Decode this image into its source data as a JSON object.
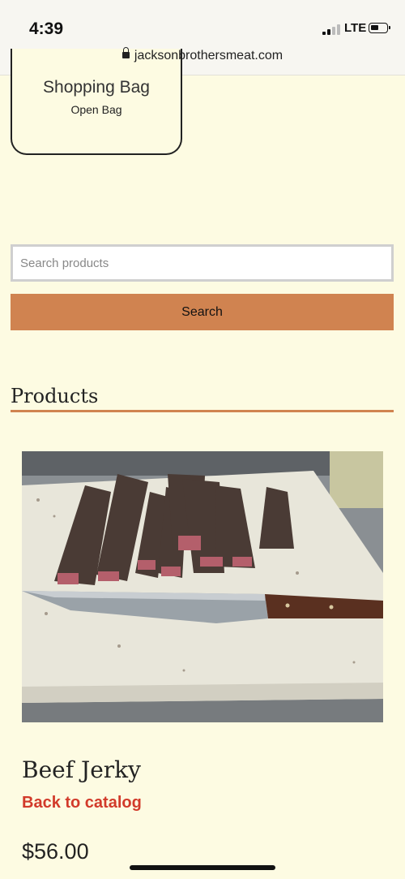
{
  "status": {
    "time": "4:39",
    "network": "LTE",
    "url": "jacksonbrothersmeat.com"
  },
  "cart": {
    "title": "Shopping Bag",
    "open_label": "Open Bag"
  },
  "search": {
    "placeholder": "Search products",
    "button_label": "Search"
  },
  "section": {
    "heading": "Products"
  },
  "product": {
    "name": "Beef Jerky",
    "back_label": "Back to catalog",
    "price": "$56.00"
  },
  "colors": {
    "background": "#fdfbe2",
    "accent": "#d08350",
    "link": "#d23a2a"
  }
}
